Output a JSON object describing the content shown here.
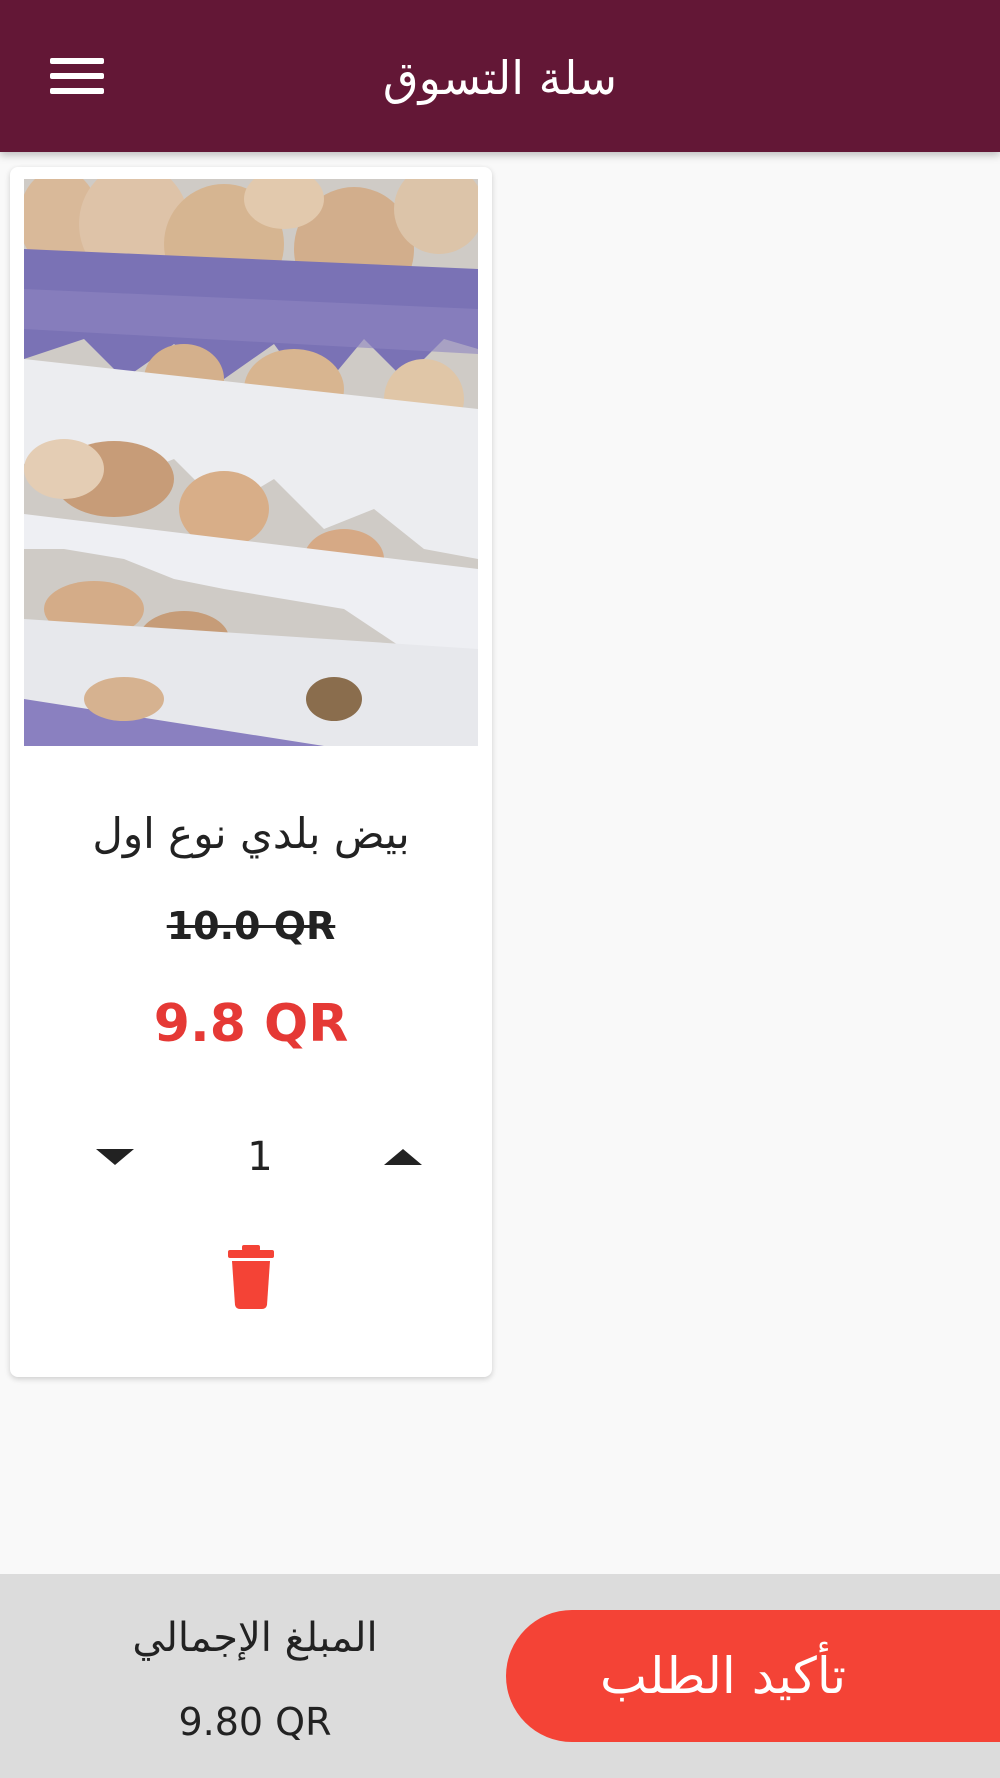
{
  "app_bar": {
    "title": "سلة التسوق",
    "menu_icon": "hamburger-menu-icon",
    "background_color": "#631736"
  },
  "cart": {
    "items": [
      {
        "name": "بيض بلدي نوع اول",
        "old_price": "10.0 QR",
        "new_price": "9.8 QR",
        "quantity": "1",
        "image": "eggs-in-trays-photo",
        "decrease_icon": "triangle-down-icon",
        "increase_icon": "triangle-up-icon",
        "delete_icon": "trash-icon"
      }
    ]
  },
  "footer": {
    "total_label": "المبلغ الإجمالي",
    "total_value": "9.80 QR",
    "confirm_label": "تأكيد الطلب"
  },
  "colors": {
    "accent": "#f44336",
    "price_red": "#e53935",
    "footer_bg": "#dcdcdc"
  }
}
